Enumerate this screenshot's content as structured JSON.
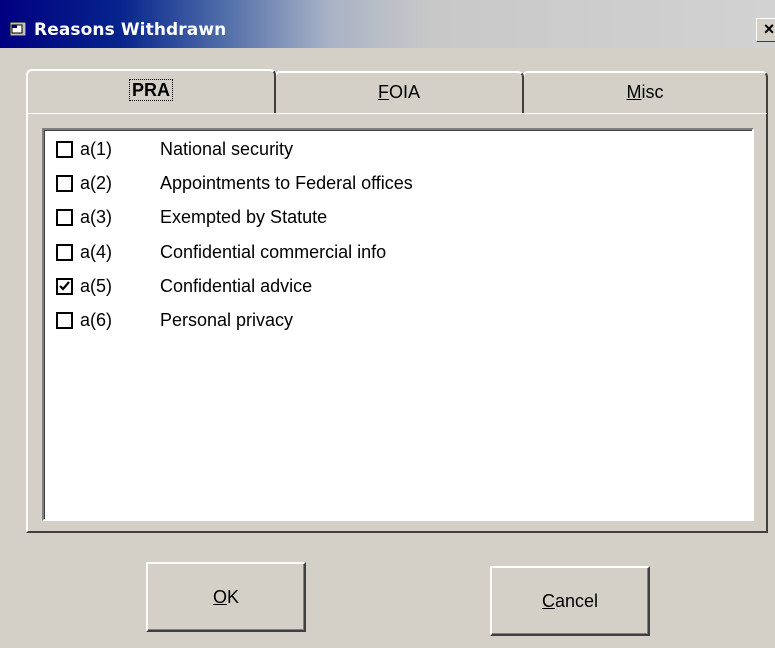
{
  "window": {
    "title": "Reasons Withdrawn",
    "icon": "folder-icon",
    "close_label": "×"
  },
  "tabs": [
    {
      "label": "PRA",
      "selected": true
    },
    {
      "label": "FOIA",
      "selected": false
    },
    {
      "label": "Misc",
      "selected": false
    }
  ],
  "reasons": [
    {
      "code": "a(1)",
      "description": "National security",
      "checked": false
    },
    {
      "code": "a(2)",
      "description": "Appointments to Federal offices",
      "checked": false
    },
    {
      "code": "a(3)",
      "description": "Exempted by Statute",
      "checked": false
    },
    {
      "code": "a(4)",
      "description": "Confidential commercial info",
      "checked": false
    },
    {
      "code": "a(5)",
      "description": "Confidential advice",
      "checked": true
    },
    {
      "code": "a(6)",
      "description": "Personal privacy",
      "checked": false
    }
  ],
  "buttons": {
    "ok_label": "OK",
    "cancel_label": "Cancel"
  }
}
